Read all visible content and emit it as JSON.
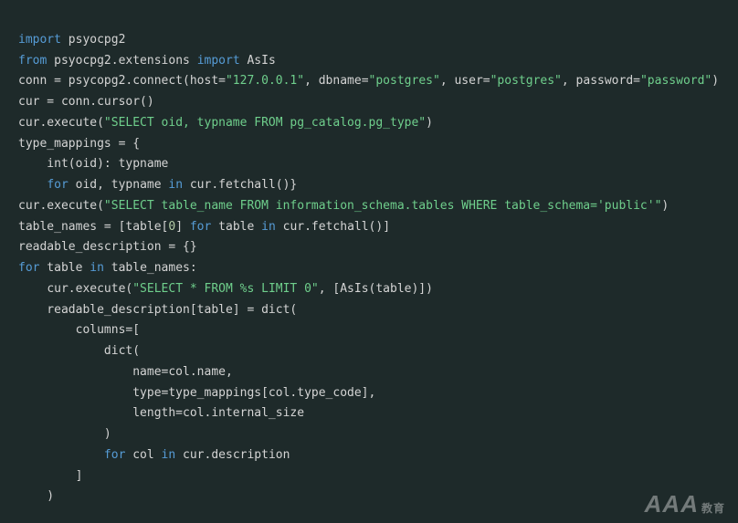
{
  "watermark": {
    "brand": "AAA",
    "suffix": "教育"
  },
  "code": {
    "l1": {
      "kw1": "import",
      "mod": "psyocpg2"
    },
    "l2": {
      "kw1": "from",
      "mod": "psyocpg2.extensions",
      "kw2": "import",
      "cls": "AsIs"
    },
    "l3": {
      "lhs": "conn = psycopg2.connect(host=",
      "s1": "\"127.0.0.1\"",
      "c1": ", dbname=",
      "s2": "\"postgres\"",
      "c2": ", user=",
      "s3": "\"postgres\"",
      "c3": ", password=",
      "s4": "\"password\"",
      "end": ")"
    },
    "l4": {
      "txt": "cur = conn.cursor()"
    },
    "l5": {
      "pre": "cur.execute(",
      "s": "\"SELECT oid, typname FROM pg_catalog.pg_type\"",
      "post": ")"
    },
    "l6": {
      "txt": "type_mappings = {"
    },
    "l7": {
      "pre": "    int(oid)",
      "colon": ": ",
      "val": "typname"
    },
    "l8": {
      "ind": "    ",
      "kw1": "for",
      "vars": " oid, typname ",
      "kw2": "in",
      "call": " cur.fetchall()}"
    },
    "l9": {
      "pre": "cur.execute(",
      "s": "\"SELECT table_name FROM information_schema.tables WHERE table_schema='public'\"",
      "post": ")"
    },
    "l10": {
      "pre": "table_names = [table[",
      "num": "0",
      "mid": "] ",
      "kw1": "for",
      "v1": " table ",
      "kw2": "in",
      "call": " cur.fetchall()]"
    },
    "l11": {
      "txt": "readable_description = {}"
    },
    "l12": {
      "kw1": "for",
      "v": " table ",
      "kw2": "in",
      "rest": " table_names:"
    },
    "l13": {
      "ind": "    ",
      "pre": "cur.execute(",
      "s": "\"SELECT * FROM %s LIMIT 0\"",
      "post": ", [AsIs(table)])"
    },
    "l14": {
      "txt": "    readable_description[table] = dict("
    },
    "l15": {
      "txt": "        columns=["
    },
    "l16": {
      "txt": "            dict("
    },
    "l17": {
      "txt": "                name=col.name,"
    },
    "l18": {
      "txt": "                type=type_mappings[col.type_code],"
    },
    "l19": {
      "txt": "                length=col.internal_size"
    },
    "l20": {
      "txt": "            )"
    },
    "l21": {
      "ind": "            ",
      "kw1": "for",
      "v": " col ",
      "kw2": "in",
      "rest": " cur.description"
    },
    "l22": {
      "txt": "        ]"
    },
    "l23": {
      "txt": "    )"
    }
  }
}
